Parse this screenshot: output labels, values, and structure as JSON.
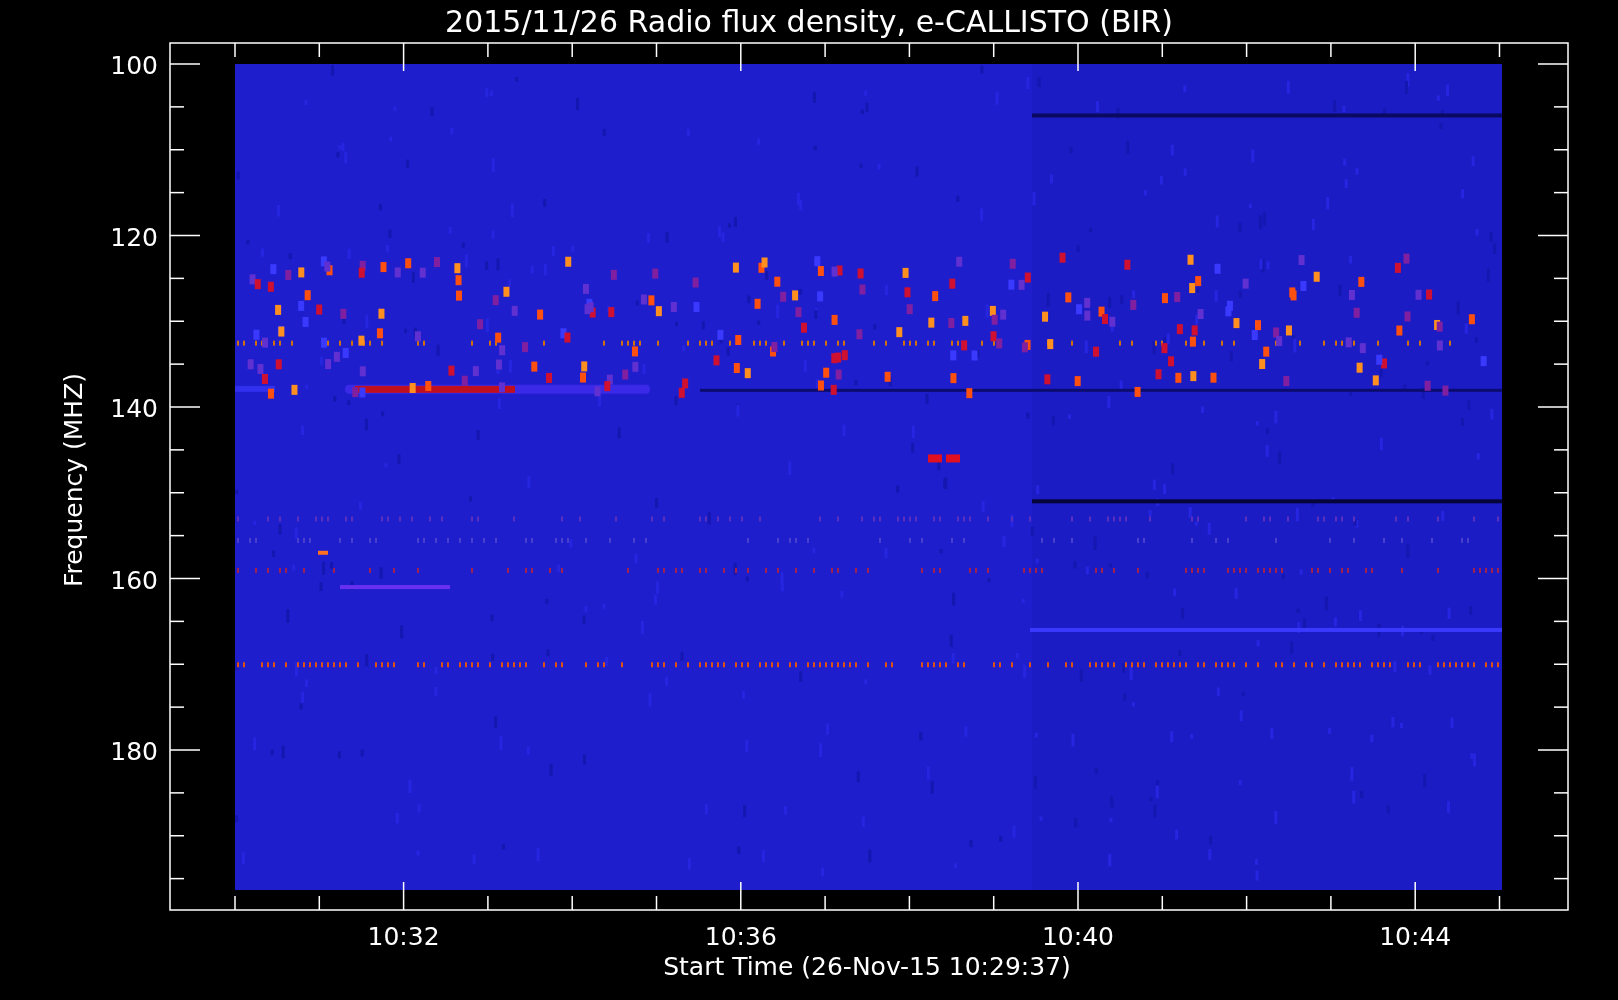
{
  "title": "2015/11/26  Radio flux density, e-CALLISTO (BIR)",
  "y_axis": {
    "label": "Frequency (MHZ)",
    "ticks": [
      "100",
      "120",
      "140",
      "160",
      "180"
    ]
  },
  "x_axis": {
    "label": "Start Time (26-Nov-15 10:29:37)",
    "ticks": [
      "10:32",
      "10:36",
      "10:40",
      "10:44"
    ]
  }
}
